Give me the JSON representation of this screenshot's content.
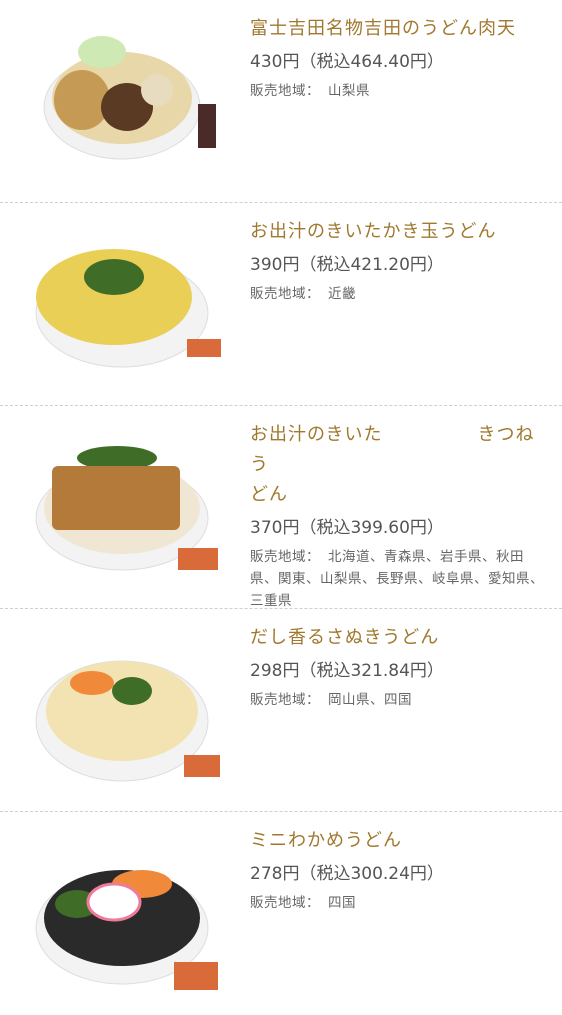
{
  "products": [
    {
      "name": "富士吉田名物吉田のうどん肉天",
      "price": "430円（税込464.40円）",
      "region_label": "販売地域：",
      "region": "山梨県"
    },
    {
      "name": "お出汁のきいたかき玉うどん",
      "price": "390円（税込421.20円）",
      "region_label": "販売地域：",
      "region": "近畿"
    },
    {
      "name_a": "お出汁のきいた",
      "name_b": "きつねう",
      "name_c": "どん",
      "price": "370円（税込399.60円）",
      "region_label": "販売地域：",
      "region": "北海道、青森県、岩手県、秋田県、関東、山梨県、長野県、岐阜県、愛知県、三重県"
    },
    {
      "name": "だし香るさぬきうどん",
      "price": "298円（税込321.84円）",
      "region_label": "販売地域：",
      "region": "岡山県、四国"
    },
    {
      "name": "ミニわかめうどん",
      "price": "278円（税込300.24円）",
      "region_label": "販売地域：",
      "region": "四国"
    }
  ],
  "icons": [
    "udon-bowl-nikuten",
    "udon-bowl-kakitama",
    "udon-bowl-kitsune",
    "udon-bowl-sanuki",
    "udon-bowl-wakame"
  ]
}
